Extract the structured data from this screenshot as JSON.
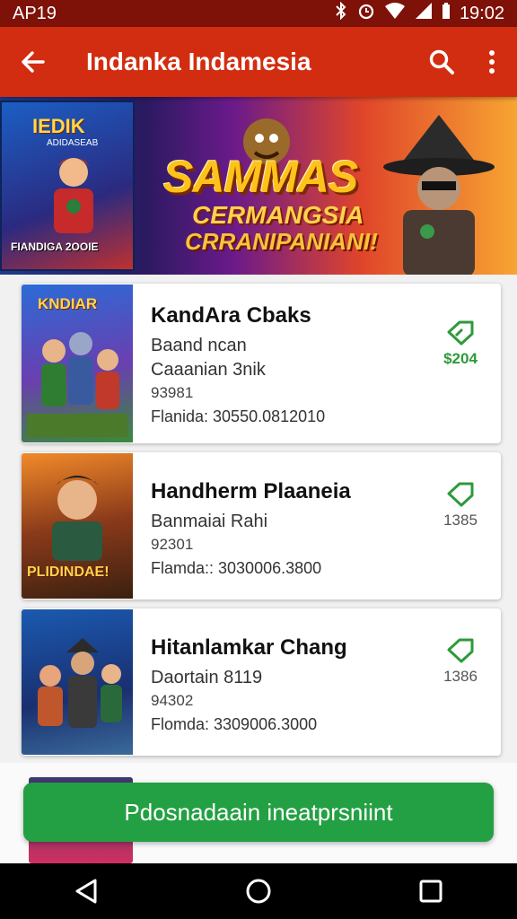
{
  "status_bar": {
    "app_label": "AP19",
    "time": "19:02"
  },
  "app_bar": {
    "title": "Indanka Indamesia"
  },
  "banner": {
    "left_title": "IEDIK",
    "left_subtitle": "ADIDASEAB",
    "left_caption": "FIANDIGA 2OOIE",
    "headline": "SAMMAS",
    "line2": "CERMANGSIA",
    "line3": "CRRANIPANIANI!"
  },
  "items": [
    {
      "title": "KandAra Cbaks",
      "subtitle": "Baand ncan",
      "subtitle2": "Caaanian 3nik",
      "code": "93981",
      "meta": "Flanida: 30550.0812010",
      "price": "$204",
      "accent": "#2e9a3a",
      "thumb_text": "KNDIAR"
    },
    {
      "title": "Handherm Plaaneia",
      "subtitle": "Banmaiai Rahi",
      "code": "92301",
      "meta": "Flamda:: 3030006.3800",
      "price": "1385",
      "accent": "#2e9a3a",
      "thumb_text": "PLIDINDAE!"
    },
    {
      "title": "Hitanlamkar Chang",
      "subtitle": "Daortain 8119",
      "code": "94302",
      "meta": "Flomda: 3309006.3000",
      "price": "1386",
      "accent": "#2e9a3a"
    }
  ],
  "install_button": {
    "label": "Pdosnadaain ineatprsniint"
  },
  "colors": {
    "app_bar": "#d22d10",
    "status_bar": "#7e1208",
    "install": "#23a043"
  }
}
